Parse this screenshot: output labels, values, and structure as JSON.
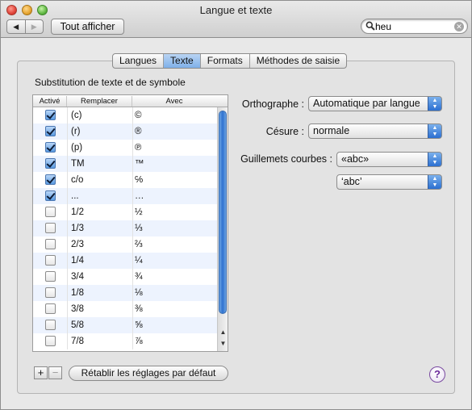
{
  "window": {
    "title": "Langue et texte",
    "show_all": "Tout afficher",
    "back_glyph": "◀",
    "forward_glyph": "▶"
  },
  "search": {
    "value": "heu"
  },
  "tabs": [
    {
      "label": "Langues",
      "selected": false
    },
    {
      "label": "Texte",
      "selected": true
    },
    {
      "label": "Formats",
      "selected": false
    },
    {
      "label": "Méthodes de saisie",
      "selected": false
    }
  ],
  "substitution": {
    "title": "Substitution de texte et de symbole",
    "columns": {
      "active": "Activé",
      "replace": "Remplacer",
      "with": "Avec"
    },
    "rows": [
      {
        "active": true,
        "replace": "(c)",
        "with": "©"
      },
      {
        "active": true,
        "replace": "(r)",
        "with": "®"
      },
      {
        "active": true,
        "replace": "(p)",
        "with": "℗"
      },
      {
        "active": true,
        "replace": "TM",
        "with": "™"
      },
      {
        "active": true,
        "replace": "c/o",
        "with": "℅"
      },
      {
        "active": true,
        "replace": "...",
        "with": "…"
      },
      {
        "active": false,
        "replace": "1/2",
        "with": "½"
      },
      {
        "active": false,
        "replace": "1/3",
        "with": "⅓"
      },
      {
        "active": false,
        "replace": "2/3",
        "with": "⅔"
      },
      {
        "active": false,
        "replace": "1/4",
        "with": "¼"
      },
      {
        "active": false,
        "replace": "3/4",
        "with": "¾"
      },
      {
        "active": false,
        "replace": "1/8",
        "with": "⅛"
      },
      {
        "active": false,
        "replace": "3/8",
        "with": "⅜"
      },
      {
        "active": false,
        "replace": "5/8",
        "with": "⅝"
      },
      {
        "active": false,
        "replace": "7/8",
        "with": "⅞"
      }
    ]
  },
  "buttons": {
    "add": "+",
    "remove": "−",
    "reset": "Rétablir les réglages par défaut",
    "help": "?"
  },
  "form": {
    "spelling_label": "Orthographe :",
    "spelling_value": "Automatique par langue",
    "hyphenation_label": "Césure :",
    "hyphenation_value": "normale",
    "quotes_label": "Guillemets courbes :",
    "double_quotes_value": "«abc»",
    "single_quotes_value": "‘abc’"
  },
  "colors": {
    "selected_tab": "#7fb0e9",
    "stepper": "#2b6fd1",
    "help_accent": "#6a2a9a"
  }
}
